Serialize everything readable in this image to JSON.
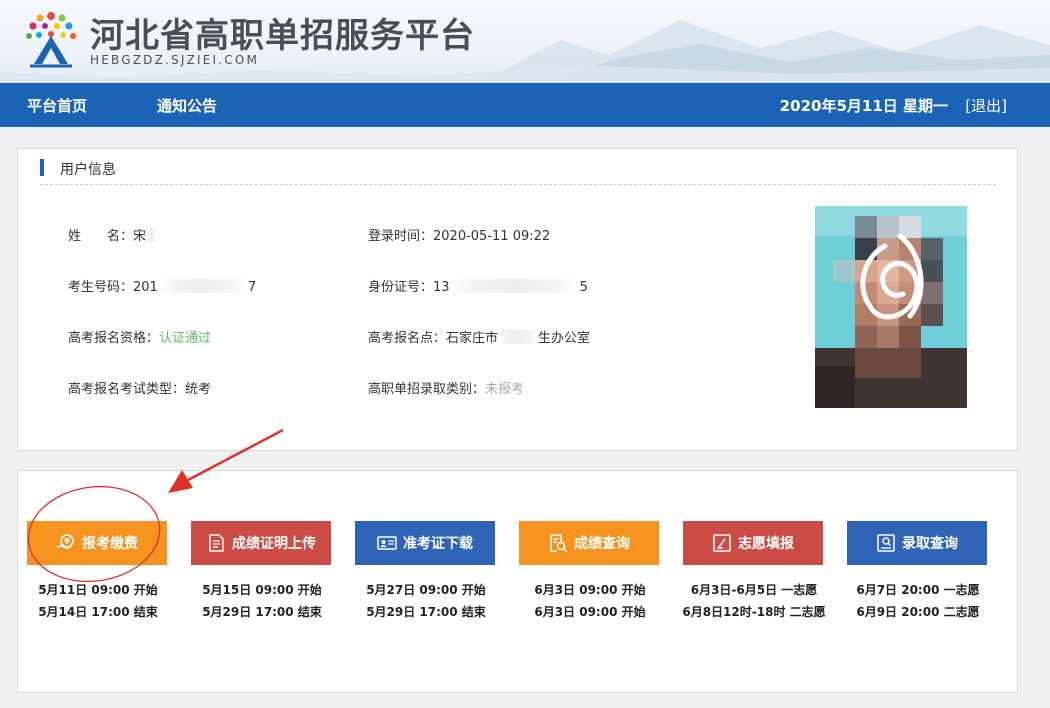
{
  "header": {
    "title": "河北省高职单招服务平台",
    "subtitle": "HEBGZDZ.SJZIEI.COM"
  },
  "nav": {
    "items": [
      {
        "label": "平台首页"
      },
      {
        "label": "通知公告"
      }
    ],
    "date": "2020年5月11日 星期一",
    "logout": "[退出]"
  },
  "user_panel": {
    "title": "用户信息",
    "fields": {
      "name_label": "姓　　名：",
      "name_value": "宋",
      "login_label": "登录时间：",
      "login_value": "2020-05-11 09:22",
      "exam_no_label": "考生号码：",
      "exam_no_prefix": "201",
      "exam_no_suffix": "7",
      "id_label": "身份证号：",
      "id_prefix": "13",
      "id_suffix": "5",
      "qual_label": "高考报名资格：",
      "qual_value": "认证通过",
      "site_label": "高考报名点：",
      "site_prefix": "石家庄市",
      "site_suffix": "生办公室",
      "type_label": "高考报名考试类型：",
      "type_value": "统考",
      "category_label": "高职单招录取类别：",
      "category_value": "未报考"
    }
  },
  "apps": [
    {
      "label": "报考缴费",
      "icon": "payment-hand-icon",
      "color": "orange",
      "line1": "5月11日 09:00 开始",
      "line2": "5月14日 17:00 结束"
    },
    {
      "label": "成绩证明上传",
      "icon": "document-icon",
      "color": "red",
      "line1": "5月15日 09:00 开始",
      "line2": "5月29日 17:00 结束"
    },
    {
      "label": "准考证下载",
      "icon": "id-card-icon",
      "color": "blue",
      "line1": "5月27日 09:00 开始",
      "line2": "5月29日 17:00 结束"
    },
    {
      "label": "成绩查询",
      "icon": "search-document-icon",
      "color": "orange",
      "line1": "6月3日 09:00 开始",
      "line2": "6月3日 09:00 开始"
    },
    {
      "label": "志愿填报",
      "icon": "edit-form-icon",
      "color": "red",
      "line1": "6月3日-6月5日 一志愿",
      "line2": "6月8日12时-18时 二志愿"
    },
    {
      "label": "录取查询",
      "icon": "search-person-icon",
      "color": "blue",
      "line1": "6月7日 20:00 一志愿",
      "line2": "6月9日 20:00 二志愿"
    }
  ],
  "colors": {
    "nav": "#1a63b5",
    "orange": "#f5931e",
    "red": "#cc4b45",
    "blue": "#2f64b6",
    "annotation": "#e0302a"
  }
}
